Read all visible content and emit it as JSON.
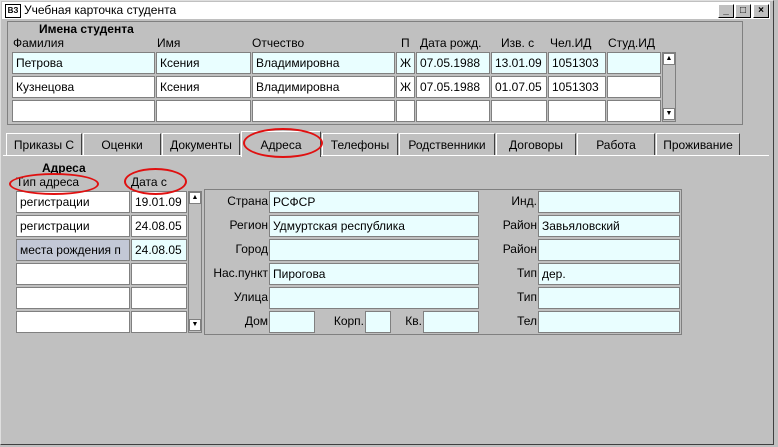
{
  "window": {
    "title": "Учебная карточка студента",
    "icon": "app-icon",
    "min_glyph": "_",
    "max_glyph": "□",
    "close_glyph": "×"
  },
  "students": {
    "section_title": "Имена студента",
    "headers": [
      "Фамилия",
      "Имя",
      "Отчество",
      "П",
      "Дата рожд.",
      "Изв. с",
      "Чел.ИД",
      "Студ.ИД"
    ],
    "rows": [
      [
        "Петрова",
        "Ксения",
        "Владимировна",
        "Ж",
        "07.05.1988",
        "13.01.09",
        "1051303",
        ""
      ],
      [
        "Кузнецова",
        "Ксения",
        "Владимировна",
        "Ж",
        "07.05.1988",
        "01.07.05",
        "1051303",
        ""
      ],
      [
        "",
        "",
        "",
        "",
        "",
        "",
        "",
        ""
      ]
    ]
  },
  "tabs": [
    "Приказы С",
    "Оценки",
    "Документы",
    "Адреса",
    "Телефоны",
    "Родственники",
    "Договоры",
    "Работа",
    "Проживание"
  ],
  "active_tab": "Адреса",
  "addresses": {
    "section_title": "Адреса",
    "col_type": "Тип адреса",
    "col_date": "Дата с",
    "rows": [
      [
        "регистрации",
        "19.01.09"
      ],
      [
        "регистрации",
        "24.08.05"
      ],
      [
        "места рождения п",
        "24.08.05"
      ],
      [
        "",
        ""
      ],
      [
        "",
        ""
      ],
      [
        "",
        ""
      ]
    ]
  },
  "detail": {
    "country_label": "Страна",
    "country": "РСФСР",
    "region_label": "Регион",
    "region": "Удмуртская республика",
    "city_label": "Город",
    "city": "",
    "settlement_label": "Нас.пункт",
    "settlement": "Пирогова",
    "street_label": "Улица",
    "street": "",
    "house_label": "Дом",
    "house": "",
    "building_label": "Корп.",
    "building": "",
    "apt_label": "Кв.",
    "apt": "",
    "index_label": "Инд.",
    "index": "",
    "district1_label": "Район",
    "district1": "Завьяловский",
    "district2_label": "Район",
    "district2": "",
    "type1_label": "Тип",
    "type1": "дер.",
    "type2_label": "Тип",
    "type2": "",
    "phone_label": "Тел",
    "phone": ""
  },
  "colors": {
    "field_bg": "#e9feff",
    "selected_bg": "#c3c8d6",
    "highlight_ellipse": "#e01010",
    "window_bg": "#c0c0c0"
  }
}
